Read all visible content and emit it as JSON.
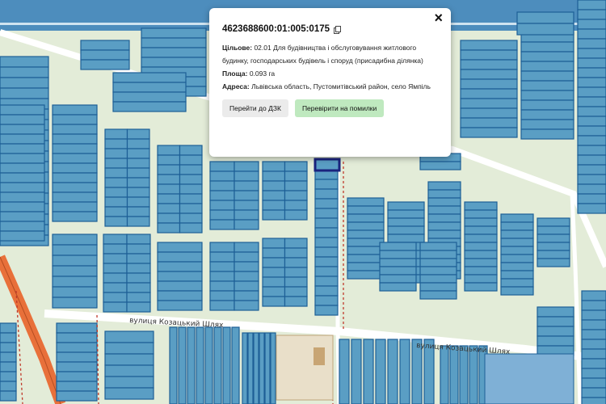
{
  "popup": {
    "cadastral_number": "4623688600:01:005:0175",
    "purpose_label": "Цільове:",
    "purpose_value": "02.01 Для будівництва і обслуговування житлового будинку, господарських будівель і споруд (присадибна ділянка)",
    "area_label": "Площа:",
    "area_value": "0.093 га",
    "address_label": "Адреса:",
    "address_value": "Львівська область, Пустомитівський район, село Ямпіль",
    "close_symbol": "×",
    "button_dzk": "Перейти до ДЗК",
    "button_check": "Перевірити на помилки",
    "icons": {
      "copy": "copy-icon",
      "close": "close-icon"
    }
  },
  "map": {
    "street_name": "вулиця Козацький Шлях",
    "colors": {
      "background": "#e3ecd8",
      "parcel_fill": "#5a9ec4",
      "parcel_stroke": "#1d5f96",
      "selected_parcel": "#1a237e",
      "road": "#ffffff",
      "main_road": "#e8703a",
      "boundary": "#c0392b"
    }
  }
}
